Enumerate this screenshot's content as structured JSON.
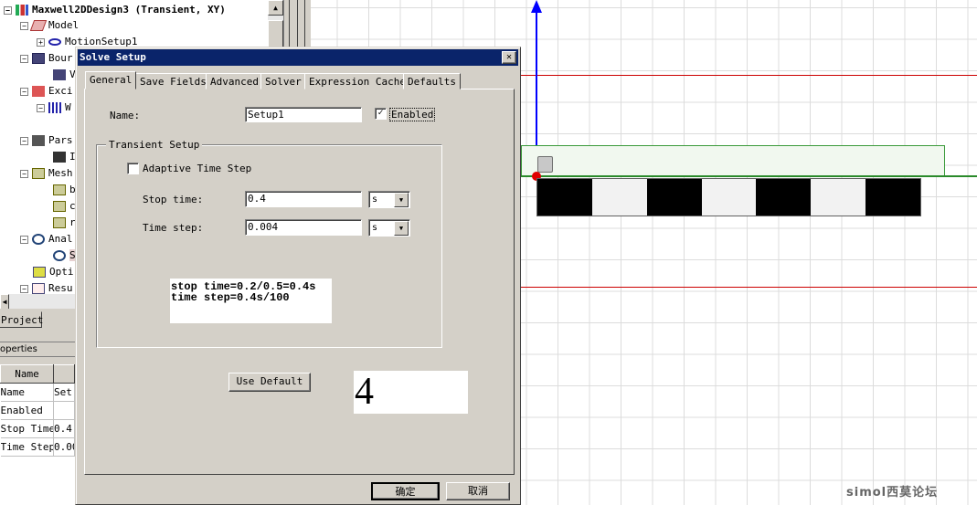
{
  "project_tree": {
    "root": "Maxwell2DDesign3 (Transient, XY)",
    "items": [
      "Model",
      "MotionSetup1",
      "Bour",
      "V",
      "Exci",
      "W",
      "",
      "Pars",
      "I",
      "Mesh",
      "b",
      "c",
      "r",
      "Anal",
      "S",
      "Opti",
      "Resu"
    ]
  },
  "project_tab": "Project",
  "properties": {
    "title": "operties",
    "header": "Name",
    "rows": [
      {
        "name": "Name",
        "value": "Set"
      },
      {
        "name": "Enabled",
        "value": ""
      },
      {
        "name": "Stop Time",
        "value": "0.4"
      },
      {
        "name": "Time Step",
        "value": "0.00"
      }
    ]
  },
  "dialog": {
    "title": "Solve Setup",
    "close_icon": "close-icon",
    "tabs": [
      "General",
      "Save Fields",
      "Advanced",
      "Solver",
      "Expression Cache",
      "Defaults"
    ],
    "active_tab": "General",
    "name_label": "Name:",
    "name_value": "Setup1",
    "enabled_label": "Enabled",
    "enabled_checked": true,
    "group_title": "Transient Setup",
    "adaptive_label": "Adaptive Time Step",
    "adaptive_checked": false,
    "stop_time_label": "Stop time:",
    "stop_time_value": "0.4",
    "stop_time_unit": "s",
    "time_step_label": "Time step:",
    "time_step_value": "0.004",
    "time_step_unit": "s",
    "note_line1": "stop time=0.2/0.5=0.4s",
    "note_line2": "time step=0.4s/100",
    "use_default": "Use Default",
    "big_number": "4",
    "ok": "确定",
    "cancel": "取消"
  },
  "watermark": "simol西莫论坛",
  "colors": {
    "titlebar": "#0a246a",
    "axis_y": "#0000ff",
    "red_lines": "#cc0000",
    "green_region": "#008000",
    "dialog_bg": "#d4d0c8"
  }
}
